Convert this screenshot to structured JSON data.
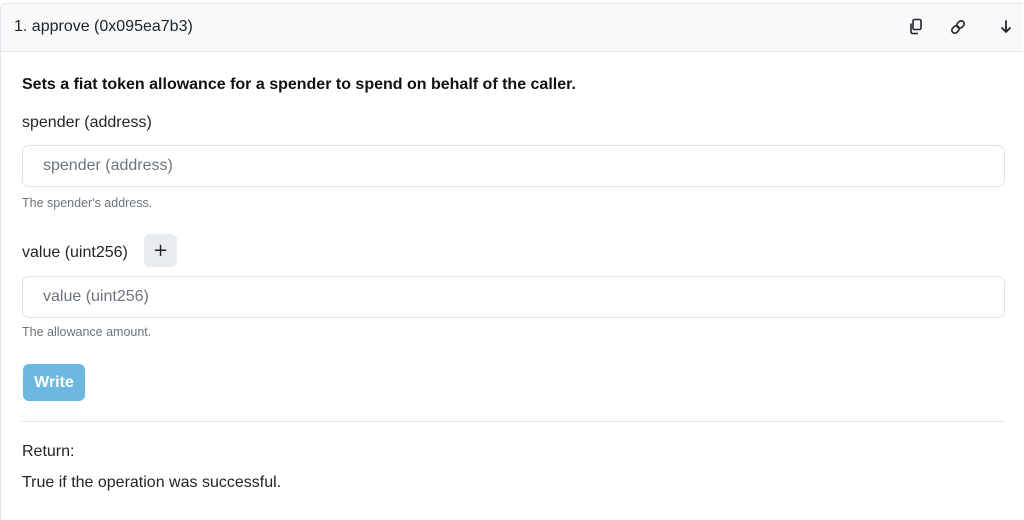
{
  "header": {
    "title": "1. approve (0x095ea7b3)",
    "icons": [
      "copy-icon",
      "link-icon",
      "arrow-down-icon"
    ]
  },
  "description": "Sets a fiat token allowance for a spender to spend on behalf of the caller.",
  "fields": [
    {
      "label": "spender (address)",
      "placeholder": "spender (address)",
      "value": "",
      "help": "The spender's address."
    },
    {
      "label": "value (uint256)",
      "placeholder": "value (uint256)",
      "value": "",
      "help": "The allowance amount.",
      "add_label": "+"
    }
  ],
  "write_label": "Write",
  "return": {
    "label": "Return:",
    "text": "True if the operation was successful."
  },
  "colors": {
    "header_bg": "#f8f9fa",
    "write_button": "#6cb8e0",
    "muted_text": "#6c757d",
    "border": "#dee2e6"
  }
}
